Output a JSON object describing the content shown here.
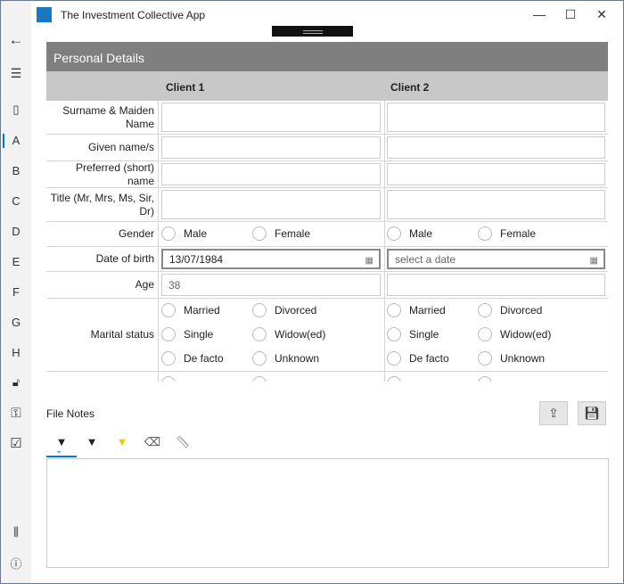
{
  "app": {
    "title": "The Investment Collective App"
  },
  "window_controls": {
    "minimize": "—",
    "maximize": "☐",
    "close": "✕"
  },
  "sidebar": {
    "back": "←",
    "menu": "☰",
    "doc": "▯",
    "letters": [
      "A",
      "B",
      "C",
      "D",
      "E",
      "F",
      "G",
      "H"
    ],
    "lock": "🔓︎",
    "key": "⚿",
    "check": "☑",
    "library": "⫼",
    "info": "ⓘ",
    "selected": "A"
  },
  "form": {
    "title": "Personal Details",
    "columns": [
      "Client 1",
      "Client 2"
    ],
    "rows": {
      "surname": "Surname & Maiden Name",
      "given": "Given name/s",
      "preferred": "Preferred (short) name",
      "title": "Title (Mr, Mrs, Ms, Sir, Dr)",
      "gender": "Gender",
      "dob": "Date of birth",
      "age": "Age",
      "marital": "Marital status"
    },
    "gender_options": [
      "Male",
      "Female"
    ],
    "marital_options": [
      "Married",
      "Divorced",
      "Single",
      "Widow(ed)",
      "De facto",
      "Unknown"
    ],
    "client1": {
      "dob": "13/07/1984",
      "age": "38"
    },
    "client2": {
      "dob_placeholder": "select a date"
    },
    "calendar_icon": "▦"
  },
  "notes": {
    "label": "File Notes",
    "share_icon": "⇪",
    "save_icon": "💾︎",
    "tools": {
      "pen": "▼",
      "pencil": "▼",
      "highlighter": "▼",
      "eraser": "⌫",
      "ruler": "📏︎"
    },
    "chevron": "⌄"
  }
}
